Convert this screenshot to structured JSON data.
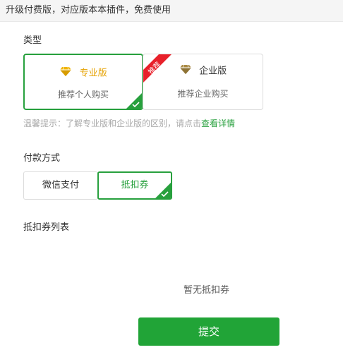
{
  "header": {
    "title": "升级付费版，对应版本本插件，免费使用"
  },
  "type_section": {
    "label": "类型",
    "cards": [
      {
        "title": "专业版",
        "subtitle": "推荐个人购买",
        "selected": true,
        "gem_color": "#f0b400"
      },
      {
        "title": "企业版",
        "subtitle": "推荐企业购买",
        "selected": false,
        "ribbon": "推荐",
        "gem_color": "#a98a44"
      }
    ],
    "hint_text": "温馨提示：了解专业版和企业版的区别，请点击",
    "hint_link": "查看详情"
  },
  "payment_section": {
    "label": "付款方式",
    "options": [
      {
        "label": "微信支付",
        "selected": false
      },
      {
        "label": "抵扣券",
        "selected": true
      }
    ]
  },
  "coupon_section": {
    "label": "抵扣券列表",
    "empty_text": "暂无抵扣券"
  },
  "submit_label": "提交",
  "colors": {
    "accent": "#27a03d",
    "ribbon": "#e8202a"
  }
}
